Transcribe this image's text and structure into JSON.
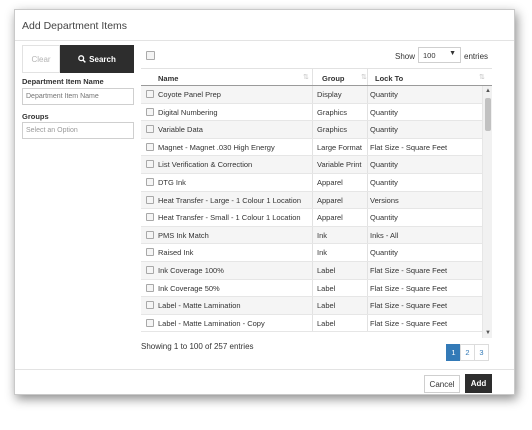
{
  "modal": {
    "title": "Add Department Items"
  },
  "filters": {
    "clear_label": "Clear",
    "search_label": "Search",
    "item_name_label": "Department Item Name",
    "item_name_placeholder": "Department Item Name",
    "groups_label": "Groups",
    "groups_placeholder": "Select an Option"
  },
  "table": {
    "show_label": "Show",
    "page_size": "100",
    "entries_label": "entries",
    "columns": [
      "Name",
      "Group",
      "Lock To"
    ],
    "rows": [
      {
        "name": "Coyote Panel Prep",
        "group": "Display",
        "lock_to": "Quantity"
      },
      {
        "name": "Digital Numbering",
        "group": "Graphics",
        "lock_to": "Quantity"
      },
      {
        "name": "Variable Data",
        "group": "Graphics",
        "lock_to": "Quantity"
      },
      {
        "name": "Magnet - Magnet .030 High Energy",
        "group": "Large Format",
        "lock_to": "Flat Size - Square Feet"
      },
      {
        "name": "List Verification & Correction",
        "group": "Variable Print",
        "lock_to": "Quantity"
      },
      {
        "name": "DTG Ink",
        "group": "Apparel",
        "lock_to": "Quantity"
      },
      {
        "name": "Heat Transfer - Large - 1 Colour 1 Location",
        "group": "Apparel",
        "lock_to": "Versions"
      },
      {
        "name": "Heat Transfer - Small - 1 Colour 1 Location",
        "group": "Apparel",
        "lock_to": "Quantity"
      },
      {
        "name": "PMS Ink Match",
        "group": "Ink",
        "lock_to": "Inks - All"
      },
      {
        "name": "Raised Ink",
        "group": "Ink",
        "lock_to": "Quantity"
      },
      {
        "name": "Ink Coverage 100%",
        "group": "Label",
        "lock_to": "Flat Size - Square Feet"
      },
      {
        "name": "Ink Coverage 50%",
        "group": "Label",
        "lock_to": "Flat Size - Square Feet"
      },
      {
        "name": "Label - Matte Lamination",
        "group": "Label",
        "lock_to": "Flat Size - Square Feet"
      },
      {
        "name": "Label - Matte Lamination - Copy",
        "group": "Label",
        "lock_to": "Flat Size - Square Feet"
      }
    ],
    "info": "Showing 1 to 100 of 257 entries",
    "pages": [
      "1",
      "2",
      "3"
    ],
    "active_page": "1"
  },
  "footer": {
    "cancel_label": "Cancel",
    "add_label": "Add"
  },
  "colors": {
    "primary_dark": "#2d2d2d",
    "link_blue": "#337ab7"
  }
}
